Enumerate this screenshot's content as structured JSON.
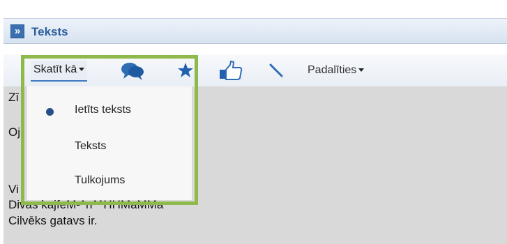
{
  "panel": {
    "title": "Teksts",
    "expand_glyph": "»"
  },
  "toolbar": {
    "view_as_label": "Skatīt kā",
    "icons": [
      "comments-icon",
      "star-icon",
      "thumbs-up-icon",
      "pencil-icon"
    ],
    "share_label": "Padalīties"
  },
  "view_menu": {
    "items": [
      {
        "label": "Ietīts teksts",
        "selected": true
      },
      {
        "label": "Teksts",
        "selected": false
      },
      {
        "label": "Tulkojums",
        "selected": false
      }
    ]
  },
  "content": {
    "lines": [
      "Zī",
      "Oj",
      "Vi",
      "Divas kajfeM-^n^^HHMaMMa",
      "Cilvēks gatavs ir."
    ]
  },
  "colors": {
    "accent": "#2c5e9e",
    "highlight_frame": "#8fba4b",
    "content_bg": "#d9d9d9"
  }
}
